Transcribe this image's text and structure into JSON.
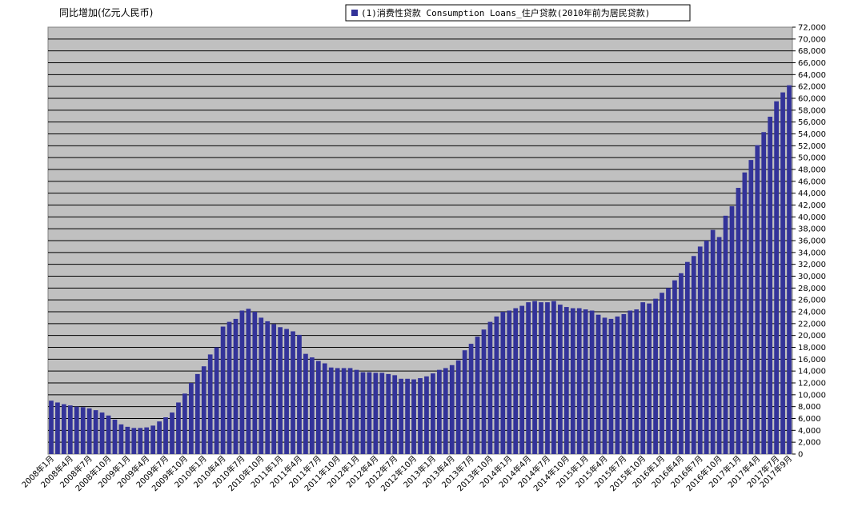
{
  "chart_data": {
    "type": "bar",
    "ylabel": "同比增加(亿元人民币)",
    "series": [
      {
        "name": "(1)消费性贷款 Consumption Loans_住户贷款(2010年前为居民贷款)",
        "color": "#333399"
      }
    ],
    "ylim": [
      0,
      72000
    ],
    "ytick_step": 2000,
    "grid": true,
    "legend_position": "top",
    "x_tick_labels": [
      "2008年1月",
      "2008年4月",
      "2008年7月",
      "2008年10月",
      "2009年1月",
      "2009年4月",
      "2009年7月",
      "2009年10月",
      "2010年1月",
      "2010年4月",
      "2010年7月",
      "2010年10月",
      "2011年1月",
      "2011年4月",
      "2011年7月",
      "2011年10月",
      "2012年1月",
      "2012年4月",
      "2012年7月",
      "2012年10月",
      "2013年1月",
      "2013年4月",
      "2013年7月",
      "2013年10月",
      "2014年1月",
      "2014年4月",
      "2014年7月",
      "2014年10月",
      "2015年1月",
      "2015年4月",
      "2015年7月",
      "2015年10月",
      "2016年1月",
      "2016年4月",
      "2016年7月",
      "2016年10月",
      "2017年1月",
      "2017年4月",
      "2017年7月",
      "2017年9月"
    ],
    "x": [
      "2008-01",
      "2008-02",
      "2008-03",
      "2008-04",
      "2008-05",
      "2008-06",
      "2008-07",
      "2008-08",
      "2008-09",
      "2008-10",
      "2008-11",
      "2008-12",
      "2009-01",
      "2009-02",
      "2009-03",
      "2009-04",
      "2009-05",
      "2009-06",
      "2009-07",
      "2009-08",
      "2009-09",
      "2009-10",
      "2009-11",
      "2009-12",
      "2010-01",
      "2010-02",
      "2010-03",
      "2010-04",
      "2010-05",
      "2010-06",
      "2010-07",
      "2010-08",
      "2010-09",
      "2010-10",
      "2010-11",
      "2010-12",
      "2011-01",
      "2011-02",
      "2011-03",
      "2011-04",
      "2011-05",
      "2011-06",
      "2011-07",
      "2011-08",
      "2011-09",
      "2011-10",
      "2011-11",
      "2011-12",
      "2012-01",
      "2012-02",
      "2012-03",
      "2012-04",
      "2012-05",
      "2012-06",
      "2012-07",
      "2012-08",
      "2012-09",
      "2012-10",
      "2012-11",
      "2012-12",
      "2013-01",
      "2013-02",
      "2013-03",
      "2013-04",
      "2013-05",
      "2013-06",
      "2013-07",
      "2013-08",
      "2013-09",
      "2013-10",
      "2013-11",
      "2013-12",
      "2014-01",
      "2014-02",
      "2014-03",
      "2014-04",
      "2014-05",
      "2014-06",
      "2014-07",
      "2014-08",
      "2014-09",
      "2014-10",
      "2014-11",
      "2014-12",
      "2015-01",
      "2015-02",
      "2015-03",
      "2015-04",
      "2015-05",
      "2015-06",
      "2015-07",
      "2015-08",
      "2015-09",
      "2015-10",
      "2015-11",
      "2015-12",
      "2016-01",
      "2016-02",
      "2016-03",
      "2016-04",
      "2016-05",
      "2016-06",
      "2016-07",
      "2016-08",
      "2016-09",
      "2016-10",
      "2016-11",
      "2016-12",
      "2017-01",
      "2017-02",
      "2017-03",
      "2017-04",
      "2017-05",
      "2017-06",
      "2017-07",
      "2017-08",
      "2017-09"
    ],
    "values": [
      9000,
      8700,
      8400,
      8200,
      8000,
      7900,
      7700,
      7400,
      7000,
      6500,
      5800,
      5000,
      4600,
      4400,
      4400,
      4500,
      4800,
      5500,
      6200,
      7000,
      8700,
      10200,
      12000,
      13500,
      14800,
      16800,
      18000,
      21500,
      22300,
      22800,
      24200,
      24500,
      24000,
      23000,
      22400,
      21900,
      21400,
      21100,
      20700,
      20100,
      16900,
      16300,
      15700,
      15300,
      14600,
      14500,
      14500,
      14500,
      14200,
      13800,
      13800,
      13700,
      13700,
      13500,
      13300,
      12700,
      12700,
      12600,
      12800,
      13100,
      13600,
      14200,
      14500,
      15000,
      15800,
      17500,
      18600,
      19800,
      21000,
      22300,
      23200,
      24000,
      24200,
      24600,
      25000,
      25600,
      25800,
      25600,
      25600,
      25800,
      25200,
      24800,
      24600,
      24600,
      24400,
      24200,
      23500,
      23000,
      22800,
      23200,
      23600,
      24200,
      24400,
      25600,
      25400,
      26200,
      27200,
      28000,
      29300,
      30500,
      32400,
      33400,
      35000,
      36000,
      37800,
      36600,
      40200,
      41800,
      44900,
      47500,
      49600,
      52100,
      54300,
      56900,
      59500,
      61000,
      62200
    ]
  }
}
